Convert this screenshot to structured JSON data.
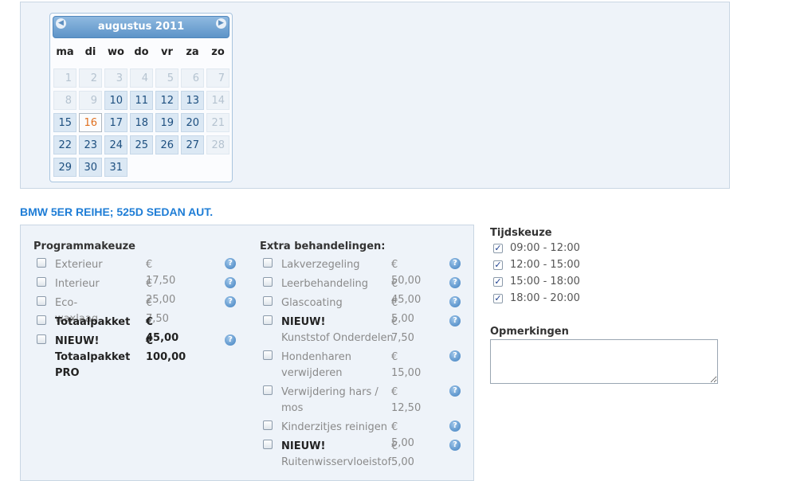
{
  "calendar": {
    "month_title": "augustus 2011",
    "prev_icon": "◀",
    "next_icon": "▶",
    "weekdays": [
      "ma",
      "di",
      "wo",
      "do",
      "vr",
      "za",
      "zo"
    ],
    "weeks": [
      [
        "1",
        "2",
        "3",
        "4",
        "5",
        "6",
        "7"
      ],
      [
        "8",
        "9",
        "10",
        "11",
        "12",
        "13",
        "14"
      ],
      [
        "15",
        "16",
        "17",
        "18",
        "19",
        "20",
        "21"
      ],
      [
        "22",
        "23",
        "24",
        "25",
        "26",
        "27",
        "28"
      ],
      [
        "29",
        "30",
        "31",
        "",
        "",
        "",
        ""
      ]
    ],
    "today": "16"
  },
  "car_title": "BMW 5ER REIHE; 525D SEDAN AUT.",
  "programmakeuze": {
    "heading": "Programmakeuze",
    "items": [
      {
        "label": "Exterieur",
        "price": "€ 17,50"
      },
      {
        "label": "Interieur",
        "price": "€ 25,00"
      },
      {
        "label": "Eco-waxlaag",
        "price": "€ 7,50"
      },
      {
        "label": "Totaalpakket",
        "price": "€ 45,00"
      },
      {
        "label": "NIEUW!",
        "label2": "Totaalpakket",
        "label3": "PRO",
        "price": "€ 100,00"
      }
    ]
  },
  "extra": {
    "heading": "Extra behandelingen:",
    "items": [
      {
        "label": "Lakverzegeling",
        "price": "€ 50,00"
      },
      {
        "label": "Leerbehandeling",
        "price": "€ 45,00"
      },
      {
        "label": "Glascoating",
        "price": "€ 5,00"
      },
      {
        "label": "NIEUW!",
        "label2": "Kunststof Onderdelen",
        "price": "€ 7,50"
      },
      {
        "label": "Hondenharen",
        "label2": "verwijderen",
        "price": "€ 15,00"
      },
      {
        "label": "Verwijdering hars /",
        "label2": "mos",
        "price": "€ 12,50"
      },
      {
        "label": "Kinderzitjes reinigen",
        "price": "€ 5,00"
      },
      {
        "label": "NIEUW!",
        "label2": "Ruitenwisservloeistof",
        "price": "€ 5,00"
      }
    ]
  },
  "help_icon": "?",
  "tijdskeuze": {
    "heading": "Tijdskeuze",
    "slots": [
      "09:00 - 12:00",
      "12:00 - 15:00",
      "15:00 - 18:00",
      "18:00 - 20:00"
    ],
    "check_glyph": "✓"
  },
  "opmerkingen": {
    "heading": "Opmerkingen"
  }
}
